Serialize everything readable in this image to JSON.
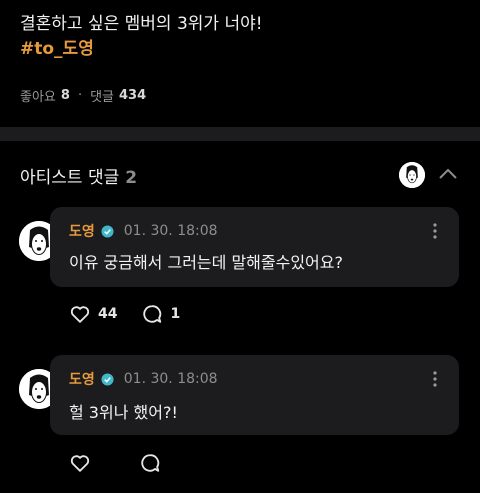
{
  "post": {
    "title": "결혼하고 싶은 멤버의 3위가 너야!",
    "tag": "#to_도영",
    "likes_label": "좋아요",
    "likes_count": "8",
    "comments_label": "댓글",
    "comments_count": "434"
  },
  "artist_comments": {
    "label": "아티스트 댓글",
    "count": "2"
  },
  "comments": [
    {
      "author": "도영",
      "date": "01. 30. 18:08",
      "text": "이유 궁금해서 그러는데 말해줄수있어요?",
      "likes": "44",
      "replies": "1"
    },
    {
      "author": "도영",
      "date": "01. 30. 18:08",
      "text": "헐 3위나 했어?!",
      "likes": "",
      "replies": ""
    }
  ],
  "icons": {
    "verified": "verified-badge-icon",
    "more": "more-vertical-icon",
    "like": "heart-icon",
    "reply": "speech-bubble-icon",
    "collapse": "chevron-up-icon"
  },
  "colors": {
    "accent": "#e69a3c",
    "background": "#000000",
    "bubble": "#1c1c1e",
    "verified": "#3fb8c9"
  }
}
